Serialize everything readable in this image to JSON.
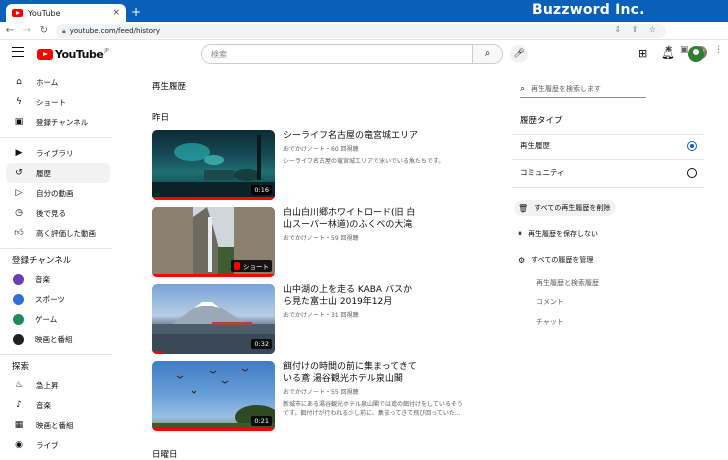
{
  "browser": {
    "tab_title": "YouTube",
    "tab_close": "×",
    "new_tab": "+",
    "url": "youtube.com/feed/history",
    "brand": "Buzzword Inc.",
    "profile_initials": "BW"
  },
  "header": {
    "logo_text": "YouTube",
    "logo_region": "JP",
    "search_placeholder": "検索"
  },
  "sidebar": {
    "main_items": [
      {
        "label": "ホーム",
        "icon": "home-icon"
      },
      {
        "label": "ショート",
        "icon": "shorts-icon"
      },
      {
        "label": "登録チャンネル",
        "icon": "subscriptions-icon"
      }
    ],
    "library_items": [
      {
        "label": "ライブラリ",
        "icon": "library-icon"
      },
      {
        "label": "履歴",
        "icon": "history-icon",
        "active": true
      },
      {
        "label": "自分の動画",
        "icon": "my-videos-icon"
      },
      {
        "label": "後で見る",
        "icon": "watch-later-icon"
      },
      {
        "label": "高く評価した動画",
        "icon": "liked-icon"
      }
    ],
    "subscriptions_heading": "登録チャンネル",
    "subscriptions": [
      {
        "label": "音楽",
        "color": "#6a3fb5"
      },
      {
        "label": "スポーツ",
        "color": "#2f6fd1"
      },
      {
        "label": "ゲーム",
        "color": "#1e8a5a"
      },
      {
        "label": "映画と番組",
        "color": "#202020"
      }
    ],
    "explore_heading": "探索",
    "explore_items": [
      {
        "label": "急上昇",
        "icon": "trending-icon"
      },
      {
        "label": "音楽",
        "icon": "music-icon"
      },
      {
        "label": "映画と番組",
        "icon": "movies-icon"
      },
      {
        "label": "ライブ",
        "icon": "live-icon"
      }
    ]
  },
  "main": {
    "title": "再生履歴",
    "day_yesterday": "昨日",
    "day_sunday": "日曜日",
    "videos": [
      {
        "title_line1": "シーライフ名古屋の竜宮城エリア",
        "title_line2": "",
        "meta": "おでかけノート・60 回視聴",
        "desc_line1": "シーライフ名古屋の竜宮城エリアで泳いでいる魚たちです。",
        "desc_line2": "",
        "duration": "0:16"
      },
      {
        "title_line1": "白山白川郷ホワイトロード(旧 白",
        "title_line2": "山スーパー林道)のふくべの大滝",
        "meta": "おでかけノート・59 回視聴",
        "desc_line1": "",
        "desc_line2": "",
        "duration": "ショート"
      },
      {
        "title_line1": "山中湖の上を走る KABA バスか",
        "title_line2": "ら見た富士山 2019年12月",
        "meta": "おでかけノート・31 回視聴",
        "desc_line1": "",
        "desc_line2": "",
        "duration": "0:32"
      },
      {
        "title_line1": "餌付けの時間の前に集まってきて",
        "title_line2": "いる鳶 湯谷観光ホテル泉山閣",
        "meta": "おでかけノート・55 回視聴",
        "desc_line1": "新城市にある湯谷観光ホテル泉山閣では鳶の餌付けをしているそう",
        "desc_line2": "です。餌付けが行われる少し前に、集まってきて飛び回っていた...",
        "duration": "0:21"
      }
    ]
  },
  "right_panel": {
    "search_placeholder": "再生履歴を検索します",
    "history_type_heading": "履歴タイプ",
    "options": [
      {
        "label": "再生履歴",
        "selected": true
      },
      {
        "label": "コミュニティ",
        "selected": false
      }
    ],
    "clear_all": "すべての再生履歴を削除",
    "pause": "再生履歴を保存しない",
    "manage": "すべての履歴を管理",
    "links": [
      "再生履歴と検索履歴",
      "コメント",
      "チャット"
    ]
  },
  "colors": {
    "titlebar": "#0a5fb8",
    "yt_red": "#ff0000",
    "radio_blue": "#065fd4"
  }
}
